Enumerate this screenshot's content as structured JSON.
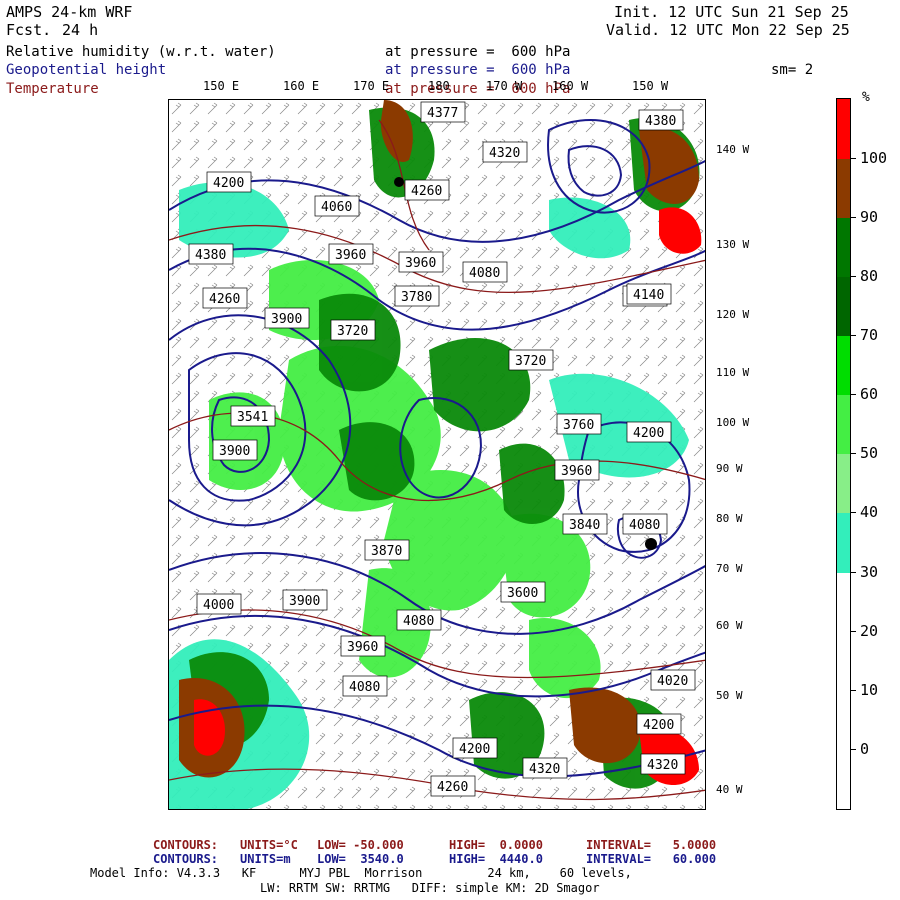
{
  "header": {
    "model": "AMPS 24-km WRF",
    "fcst_label": "Fcst.",
    "fcst_value": "24 h",
    "init": "Init. 12 UTC Sun 21 Sep 25",
    "valid": "Valid. 12 UTC Mon 22 Sep 25"
  },
  "fields": [
    {
      "name": "Relative humidity (w.r.t. water)",
      "level": "at pressure =  600 hPa",
      "color": "#000000"
    },
    {
      "name": "Geopotential height",
      "level": "at pressure =  600 hPa",
      "color": "#1a1a8c"
    },
    {
      "name": "Temperature",
      "level": "at pressure =  600 hPa",
      "color": "#8b1a1a"
    }
  ],
  "smoothing": "sm= 2",
  "lon_labels": [
    "150 E",
    "160 E",
    "170 E",
    "180",
    "170 W",
    "160 W",
    "150 W"
  ],
  "lat_labels": [
    "140 W",
    "130 W",
    "120 W",
    "110 W",
    "100 W",
    "90 W",
    "80 W",
    "70 W",
    "60 W",
    "50 W",
    "40 W"
  ],
  "colorbar": {
    "unit": "%",
    "labels": [
      "100",
      "90",
      "80",
      "70",
      "60",
      "50",
      "40",
      "30",
      "20",
      "10",
      "0"
    ],
    "colors": [
      "#ff0000",
      "#8b3a00",
      "#007700",
      "#006600",
      "#00dd00",
      "#44ee44",
      "#88ee88",
      "#33eebb",
      "#ffffff",
      "#ffffff",
      "#ffffff",
      "#ffffff"
    ]
  },
  "height_labels": [
    "4377",
    "4320",
    "4380",
    "4200",
    "4260",
    "4060",
    "4380",
    "4260",
    "3960",
    "3960",
    "4080",
    "4140",
    "3780",
    "3900",
    "3720",
    "3720",
    "3541",
    "3900",
    "4200",
    "3760",
    "3960",
    "3870",
    "3600",
    "3900",
    "4080",
    "3840",
    "4000",
    "3960",
    "4080",
    "4020",
    "4200",
    "4260",
    "4320",
    "4200",
    "4320",
    "4080",
    "4140"
  ],
  "contours_temp": {
    "label": "CONTOURS:",
    "units": "UNITS=°C",
    "low": "LOW= -50.000",
    "high": "HIGH=  0.0000",
    "interval": "INTERVAL=   5.0000",
    "color": "#8b1a1a"
  },
  "contours_height": {
    "label": "CONTOURS:",
    "units": "UNITS=m",
    "low": "LOW=  3540.0",
    "high": "HIGH=  4440.0",
    "interval": "INTERVAL=   60.000",
    "color": "#1a1a8c"
  },
  "model_info": {
    "line1": "Model Info: V4.3.3   KF      MYJ PBL  Morrison         24 km,    60 levels,",
    "line2": "LW: RRTM SW: RRTMG   DIFF: simple KM: 2D Smagor"
  }
}
